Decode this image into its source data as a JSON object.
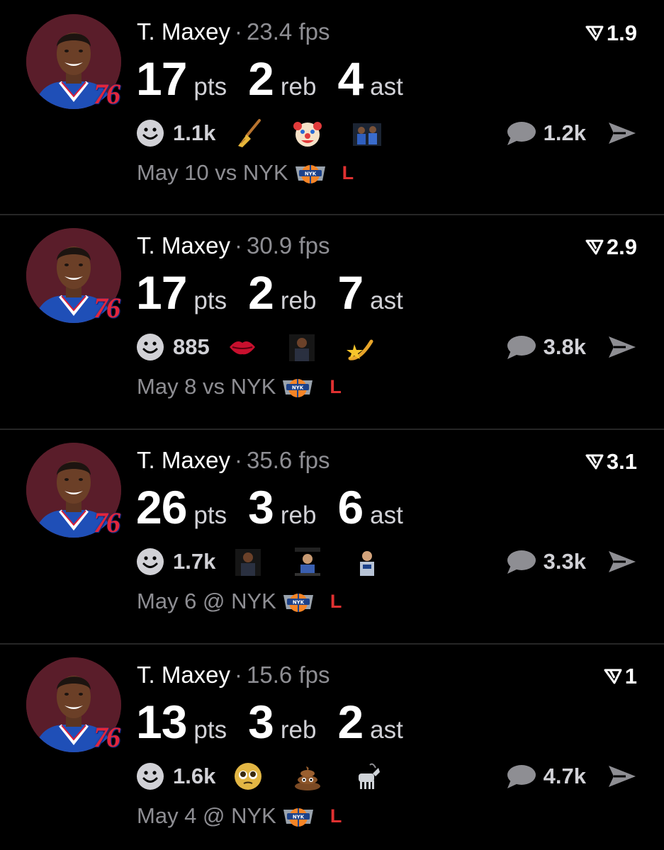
{
  "colors": {
    "background": "#000000",
    "secondary_text": "#8e8e93",
    "loss_red": "#e03131",
    "avatar_bg": "#5a1d2a",
    "jersey_blue": "#1f4fb7"
  },
  "cards": [
    {
      "player": "T. Maxey",
      "separator": "·",
      "fps": "23.4 fps",
      "rating": "1.9",
      "pts": "17",
      "pts_label": "pts",
      "reb": "2",
      "reb_label": "reb",
      "ast": "4",
      "ast_label": "ast",
      "team_logo": "76",
      "reaction_count": "1.1k",
      "reaction_icons": [
        "broom-emoji",
        "clown-emoji",
        "custom-sticker-players"
      ],
      "comment_count": "1.2k",
      "game": "May 10 vs NYK",
      "result": "L"
    },
    {
      "player": "T. Maxey",
      "separator": "·",
      "fps": "30.9 fps",
      "rating": "2.9",
      "pts": "17",
      "pts_label": "pts",
      "reb": "2",
      "reb_label": "reb",
      "ast": "7",
      "ast_label": "ast",
      "team_logo": "76",
      "reaction_count": "885",
      "reaction_icons": [
        "lips-emoji",
        "custom-sticker-player",
        "shooting-star-emoji"
      ],
      "comment_count": "3.8k",
      "game": "May 8 vs NYK",
      "result": "L"
    },
    {
      "player": "T. Maxey",
      "separator": "·",
      "fps": "35.6 fps",
      "rating": "3.1",
      "pts": "26",
      "pts_label": "pts",
      "reb": "3",
      "reb_label": "reb",
      "ast": "6",
      "ast_label": "ast",
      "team_logo": "76",
      "reaction_count": "1.7k",
      "reaction_icons": [
        "custom-sticker-player",
        "custom-sticker-player-caption",
        "custom-sticker-player-dallas"
      ],
      "comment_count": "3.3k",
      "game": "May 6 @ NYK",
      "result": "L"
    },
    {
      "player": "T. Maxey",
      "separator": "·",
      "fps": "15.6 fps",
      "rating": "1",
      "pts": "13",
      "pts_label": "pts",
      "reb": "3",
      "reb_label": "reb",
      "ast": "2",
      "ast_label": "ast",
      "team_logo": "76",
      "reaction_count": "1.6k",
      "reaction_icons": [
        "pleading-face-emoji",
        "poop-emoji",
        "goat-emoji"
      ],
      "comment_count": "4.7k",
      "game": "May 4 @ NYK",
      "result": "L"
    }
  ]
}
